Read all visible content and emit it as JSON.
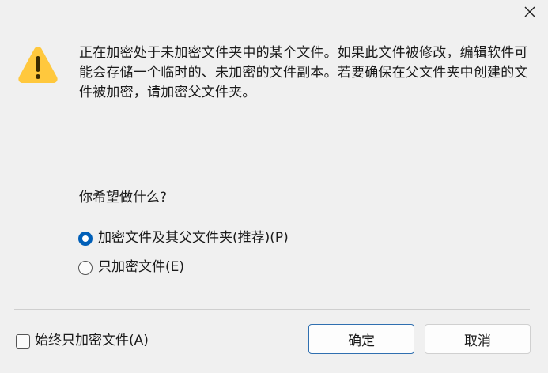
{
  "dialog": {
    "close_label": "×",
    "message": "正在加密处于未加密文件夹中的某个文件。如果此文件被修改，编辑软件可能会存储一个临时的、未加密的文件副本。若要确保在父文件夹中创建的文件被加密，请加密父文件夹。",
    "question": "你希望做什么?",
    "options": [
      {
        "label": "加密文件及其父文件夹(推荐)(P)",
        "selected": true
      },
      {
        "label": "只加密文件(E)",
        "selected": false
      }
    ],
    "always_checkbox": {
      "label": "始终只加密文件(A)",
      "checked": false
    },
    "buttons": {
      "ok_label": "确定",
      "cancel_label": "取消"
    },
    "icons": {
      "warning": "warning-triangle-icon",
      "close": "close-icon"
    },
    "colors": {
      "accent": "#005fb8",
      "warning_fill": "#ffc83d"
    }
  }
}
